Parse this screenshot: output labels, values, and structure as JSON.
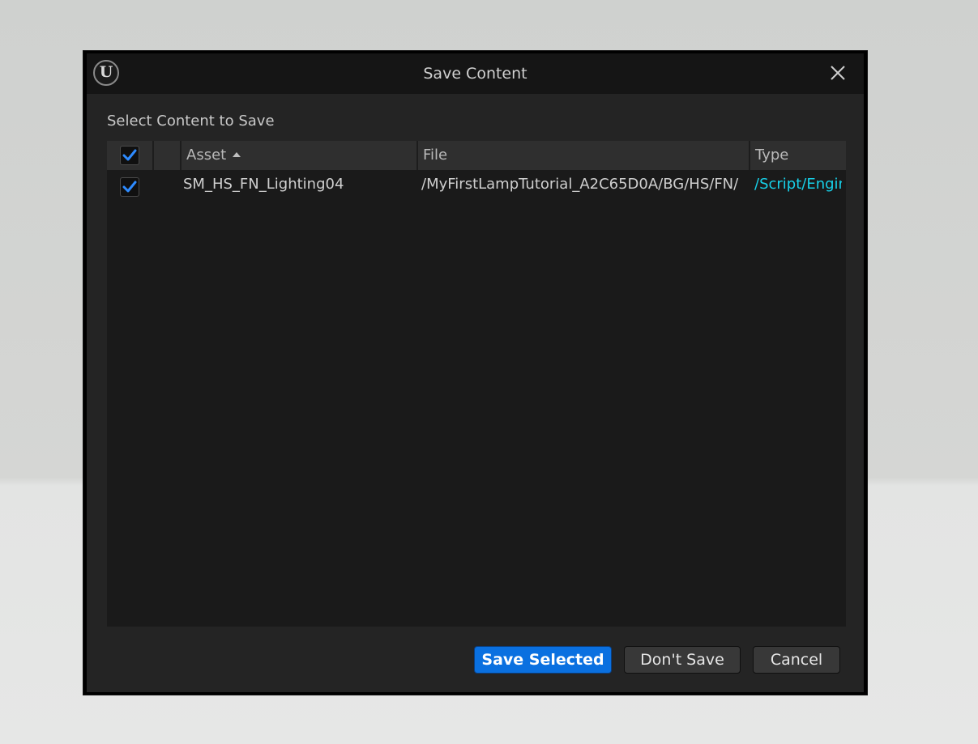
{
  "window": {
    "title": "Save Content",
    "logo_icon": "unreal-engine-logo-icon",
    "logo_glyph": "U",
    "close_icon": "close-icon"
  },
  "content": {
    "section_label": "Select Content to Save"
  },
  "table": {
    "columns": {
      "asset": "Asset",
      "file": "File",
      "type": "Type"
    },
    "sort_icon": "sort-ascending-icon",
    "select_all_checked": true,
    "rows": [
      {
        "checked": true,
        "asset": "SM_HS_FN_Lighting04",
        "file": "/MyFirstLampTutorial_A2C65D0A/BG/HS/FN/",
        "type": "/Script/Engine"
      }
    ]
  },
  "buttons": {
    "save_selected": "Save Selected",
    "dont_save": "Don't Save",
    "cancel": "Cancel"
  },
  "colors": {
    "accent": "#0A70E0",
    "type_link": "#17D0E8",
    "checkmark": "#2E8BFF"
  }
}
